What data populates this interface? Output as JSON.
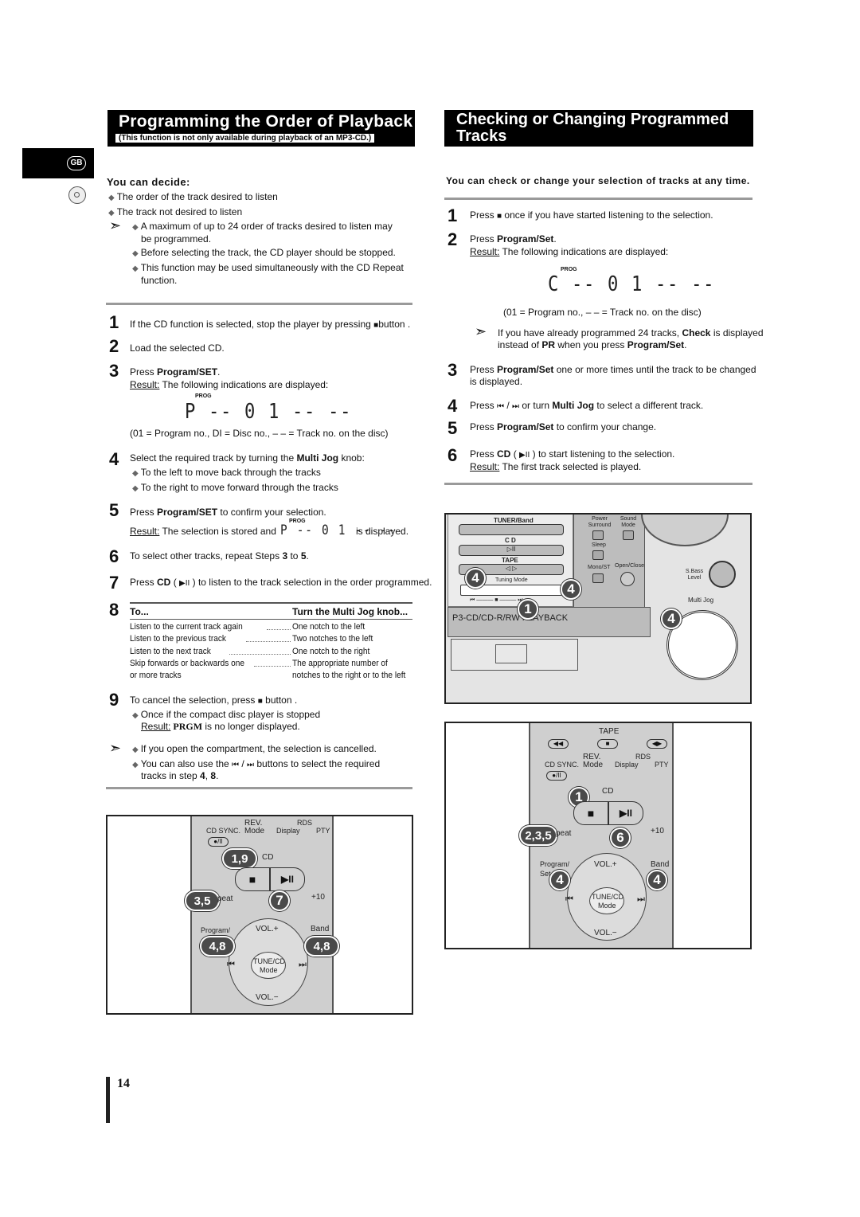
{
  "left": {
    "title": "Programming the Order of Playback",
    "subtitle": "(This function is not only available during playback of an MP3-CD.)",
    "badge": "GB",
    "decide_heading": "You can decide:",
    "decide_items": [
      "The order of the track desired to listen",
      "The track not desired to listen"
    ],
    "notes": [
      [
        "A maximum of up to 24 order of tracks desired to listen may",
        "be programmed."
      ],
      [
        "Before selecting the track, the CD player should be stopped."
      ],
      [
        "This function may be used simultaneously with the CD Repeat",
        "function."
      ]
    ],
    "steps": [
      {
        "n": "1",
        "text": [
          {
            "t": "If the CD function is selected, stop the player by pressing "
          },
          {
            "t": "■",
            "icon": "stop-icon"
          },
          {
            "t": "button ."
          }
        ]
      },
      {
        "n": "2",
        "text": [
          {
            "t": "Load the selected CD."
          }
        ]
      },
      {
        "n": "3",
        "text": [
          {
            "t": "Press "
          },
          {
            "t": "Program/SET",
            "b": 1
          },
          {
            "t": "."
          }
        ],
        "result_label": "Result:",
        "result": " The following indications are displayed:",
        "prog": "PROG",
        "display": "P -- 0 1 -- --",
        "caption": "(01 = Program no., DI = Disc no., – – = Track no. on the disc)"
      },
      {
        "n": "4",
        "text": [
          {
            "t": "Select the required track by turning the "
          },
          {
            "t": "Multi Jog",
            "b": 1
          },
          {
            "t": " knob:"
          }
        ],
        "bullets": [
          "To the left to move back through the tracks",
          "To the right to move forward through the tracks"
        ]
      },
      {
        "n": "5",
        "text": [
          {
            "t": "Press "
          },
          {
            "t": "Program/SET",
            "b": 1
          },
          {
            "t": " to confirm your selection."
          }
        ],
        "result_label": "Result:",
        "result": " The selection is stored and",
        "prog": "PROG",
        "display": "P -- 0 1 -- --",
        "result_end": "is displayed."
      },
      {
        "n": "6",
        "text": [
          {
            "t": "To select other tracks, repeat Steps "
          },
          {
            "t": "3",
            "b": 1
          },
          {
            "t": " to "
          },
          {
            "t": "5",
            "b": 1
          },
          {
            "t": "."
          }
        ]
      },
      {
        "n": "7",
        "text": [
          {
            "t": "Press "
          },
          {
            "t": "CD",
            "b": 1
          },
          {
            "t": " ( "
          },
          {
            "t": "▶II",
            "icon": "play-pause-icon"
          },
          {
            "t": " ) to listen to the track selection in the order programmed."
          }
        ]
      },
      {
        "n": "8",
        "table": {
          "headers": [
            "To...",
            "Turn the Multi Jog knob..."
          ],
          "rows": [
            [
              "Listen to the current track again",
              "One notch to the left"
            ],
            [
              "Listen to the previous track",
              "Two notches to the left"
            ],
            [
              "Listen to the next track",
              "One notch to the right"
            ],
            [
              "Skip forwards or backwards one",
              "The appropriate number of"
            ],
            [
              "or more tracks",
              "notches to the right or to the left"
            ]
          ]
        }
      },
      {
        "n": "9",
        "text": [
          {
            "t": "To cancel the selection, press "
          },
          {
            "t": "■",
            "icon": "stop-icon"
          },
          {
            "t": " button ."
          }
        ],
        "bullet": "Once if the compact disc player is stopped",
        "result_label": "Result:",
        "result_bold": " PRGM",
        "result": " is no longer displayed."
      }
    ],
    "end_notes": [
      [
        {
          "t": "If you open the compartment, the selection is cancelled."
        }
      ],
      [
        {
          "t": "You can also use the "
        },
        {
          "t": "⏮",
          "icon": "previous-track-icon"
        },
        {
          "t": " / "
        },
        {
          "t": "⏭",
          "icon": "next-track-icon"
        },
        {
          "t": " buttons to select the required"
        }
      ]
    ],
    "end_note_tail": [
      {
        "t": "tracks in step "
      },
      {
        "t": "4",
        "b": 1
      },
      {
        "t": ", "
      },
      {
        "t": "8",
        "b": 1
      },
      {
        "t": "."
      }
    ],
    "remote": {
      "rev": "REV.",
      "rds": "RDS",
      "cdsync": "CD SYNC.",
      "mode": "Mode",
      "display": "Display",
      "pty": "PTY",
      "cd": "CD",
      "c19": "1,9",
      "c35": "3,5",
      "c7": "7",
      "plus10": "+10",
      "repeat": "peat",
      "program": "Program/",
      "volup": "VOL.+",
      "band": "Band",
      "c48a": "4,8",
      "c48b": "4,8",
      "tune": "TUNE/CD",
      "tunemode": "Mode",
      "voldown": "VOL.−"
    }
  },
  "right": {
    "title": "Checking or Changing Programmed Tracks",
    "intro": "You can check or change your selection of tracks at any time.",
    "steps": [
      {
        "n": "1",
        "text": [
          {
            "t": "Press "
          },
          {
            "t": "■",
            "icon": "stop-icon"
          },
          {
            "t": " once if you have started listening to the selection."
          }
        ]
      },
      {
        "n": "2",
        "text": [
          {
            "t": "Press "
          },
          {
            "t": "Program/Set",
            "b": 1
          },
          {
            "t": "."
          }
        ],
        "result_label": "Result:",
        "result": " The following indications are displayed:",
        "prog": "PROG",
        "display": "C -- 0 1 -- --",
        "caption": "(01 = Program no., – – = Track no. on the disc)",
        "note": [
          [
            {
              "t": "If you have already programmed 24 tracks, "
            },
            {
              "t": "Check",
              "b": 1
            },
            {
              "t": " is displayed"
            }
          ],
          [
            {
              "t": "instead of "
            },
            {
              "t": "PR",
              "b": 1
            },
            {
              "t": " when you press "
            },
            {
              "t": "Program/Set",
              "b": 1
            },
            {
              "t": "."
            }
          ]
        ]
      },
      {
        "n": "3",
        "text": [
          {
            "t": "Press "
          },
          {
            "t": "Program/Set",
            "b": 1
          },
          {
            "t": " one or more times until the track to be changed"
          }
        ],
        "text2": "is displayed."
      },
      {
        "n": "4",
        "text": [
          {
            "t": "Press "
          },
          {
            "t": "⏮",
            "icon": "previous-track-icon"
          },
          {
            "t": " / "
          },
          {
            "t": "⏭",
            "icon": "next-track-icon"
          },
          {
            "t": " or turn "
          },
          {
            "t": "Multi Jog",
            "b": 1
          },
          {
            "t": " to select a different track."
          }
        ]
      },
      {
        "n": "5",
        "text": [
          {
            "t": "Press "
          },
          {
            "t": "Program/Set",
            "b": 1
          },
          {
            "t": " to confirm your change."
          }
        ]
      },
      {
        "n": "6",
        "text": [
          {
            "t": "Press "
          },
          {
            "t": "CD",
            "b": 1
          },
          {
            "t": " ( "
          },
          {
            "t": "▶II",
            "icon": "play-pause-icon"
          },
          {
            "t": " ) to start listening to the selection."
          }
        ],
        "result_label": "Result:",
        "result": " The first track selected is played."
      }
    ],
    "unit": {
      "tuner": "TUNER/Band",
      "power": "Power Surround",
      "sound": "Sound Mode",
      "cd": "C D",
      "sleep": "Sleep",
      "tape": "TAPE",
      "mono": "Mono/ST",
      "open": "Open/Close",
      "tuning": "Tuning Mode",
      "sbass": "S.Bass Level",
      "jog": "Multi Jog",
      "playback": "P3-CD/CD-R/RW PLAYBACK",
      "c1": "4",
      "c2": "4",
      "c3": "1",
      "c4": "4"
    },
    "remote": {
      "tape": "TAPE",
      "rev": "REV.",
      "rds": "RDS",
      "cdsync": "CD SYNC.",
      "mode": "Mode",
      "display": "Display",
      "pty": "PTY",
      "cd": "CD",
      "c1": "1",
      "c235": "2,3,5",
      "repeat": "peat",
      "c6": "6",
      "plus10": "+10",
      "program": "Program/",
      "set": "Set",
      "volup": "VOL.+",
      "band": "Band",
      "c4a": "4",
      "c4b": "4",
      "tune": "TUNE/CD",
      "tunemode": "Mode",
      "voldown": "VOL.−"
    }
  },
  "page_number": "14"
}
